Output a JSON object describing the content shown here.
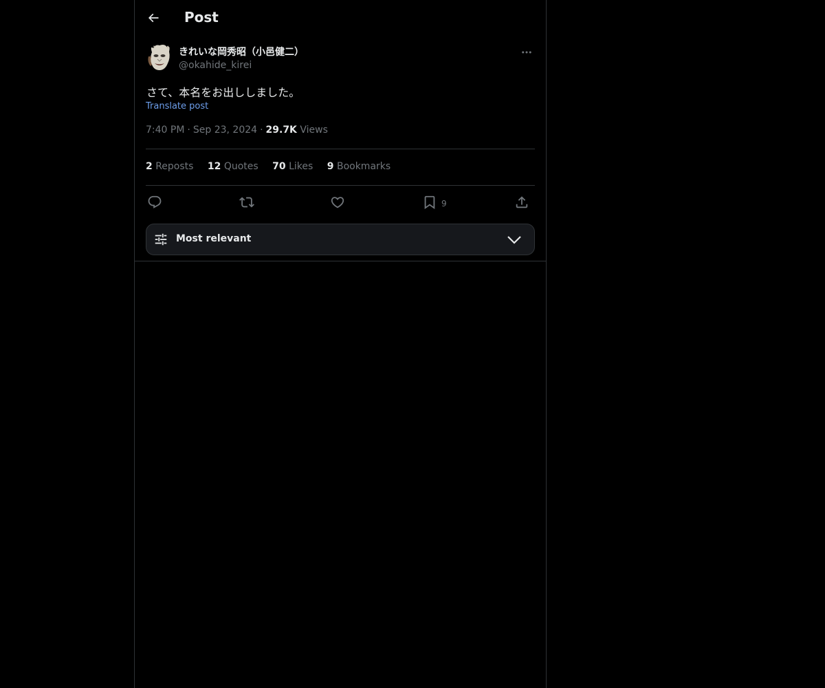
{
  "header": {
    "title": "Post",
    "back_icon": "arrow-left-icon"
  },
  "author": {
    "display_name": "きれいな岡秀昭（小邑健二）",
    "handle": "@okahide_kirei",
    "avatar_icon": "noh-mask-avatar"
  },
  "post": {
    "text": "さて、本名をお出ししました。",
    "translate_label": "Translate post",
    "time": "7:40 PM",
    "date": "Sep 23, 2024",
    "views_count": "29.7K",
    "views_label": "Views",
    "separator": "·"
  },
  "stats": [
    {
      "count": "2",
      "label": "Reposts"
    },
    {
      "count": "12",
      "label": "Quotes"
    },
    {
      "count": "70",
      "label": "Likes"
    },
    {
      "count": "9",
      "label": "Bookmarks"
    }
  ],
  "actions": {
    "reply_icon": "reply-icon",
    "repost_icon": "repost-icon",
    "like_icon": "heart-icon",
    "bookmark_icon": "bookmark-icon",
    "bookmark_count": "9",
    "share_icon": "share-icon"
  },
  "sort": {
    "label": "Most relevant"
  },
  "colors": {
    "background": "#000000",
    "text": "#e7e9ea",
    "muted": "#71767b",
    "link": "#6d9eeb",
    "border": "#2f3336"
  }
}
